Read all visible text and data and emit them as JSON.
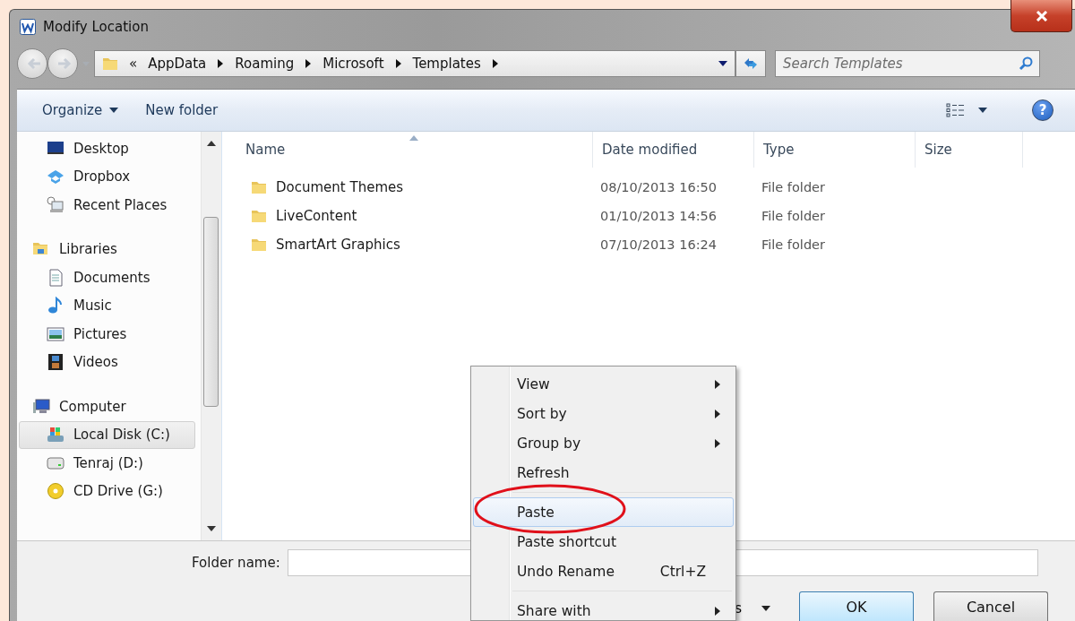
{
  "window": {
    "title": "Modify Location"
  },
  "address": {
    "overflow": "«",
    "segments": [
      "AppData",
      "Roaming",
      "Microsoft",
      "Templates"
    ]
  },
  "search": {
    "placeholder": "Search Templates"
  },
  "toolbar": {
    "organize": "Organize",
    "new_folder": "New folder",
    "help": "?"
  },
  "sidebar": {
    "sections": [
      {
        "children": [
          {
            "label": "Desktop",
            "selected": false
          },
          {
            "label": "Dropbox",
            "selected": false
          },
          {
            "label": "Recent Places",
            "selected": false
          }
        ]
      },
      {
        "label": "Libraries",
        "selected": false,
        "children": [
          {
            "label": "Documents",
            "selected": false
          },
          {
            "label": "Music",
            "selected": false
          },
          {
            "label": "Pictures",
            "selected": false
          },
          {
            "label": "Videos",
            "selected": false
          }
        ]
      },
      {
        "label": "Computer",
        "selected": false,
        "children": [
          {
            "label": "Local Disk (C:)",
            "selected": true
          },
          {
            "label": "Tenraj (D:)",
            "selected": false
          },
          {
            "label": "CD Drive (G:)",
            "selected": false
          }
        ]
      }
    ]
  },
  "table": {
    "columns": [
      "Name",
      "Date modified",
      "Type",
      "Size"
    ],
    "rows": [
      {
        "name": "Document Themes",
        "date": "08/10/2013 16:50",
        "type": "File folder"
      },
      {
        "name": "LiveContent",
        "date": "01/10/2013 14:56",
        "type": "File folder"
      },
      {
        "name": "SmartArt Graphics",
        "date": "07/10/2013 16:24",
        "type": "File folder"
      }
    ]
  },
  "folder_name": {
    "label": "Folder name:"
  },
  "buttons": [
    {
      "label": "s",
      "kind": "dropdown"
    },
    {
      "label": "OK",
      "kind": "default"
    },
    {
      "label": "Cancel",
      "kind": "plain"
    }
  ],
  "context_menu": {
    "items": [
      {
        "kind": "item",
        "label": "View",
        "submenu": true,
        "selected": false
      },
      {
        "kind": "item",
        "label": "Sort by",
        "submenu": true,
        "selected": false
      },
      {
        "kind": "item",
        "label": "Group by",
        "submenu": true,
        "selected": false
      },
      {
        "kind": "item",
        "label": "Refresh",
        "submenu": false,
        "selected": false
      },
      {
        "kind": "separator"
      },
      {
        "kind": "item",
        "label": "Paste",
        "submenu": false,
        "selected": true
      },
      {
        "kind": "item",
        "label": "Paste shortcut",
        "submenu": false,
        "selected": false
      },
      {
        "kind": "item",
        "label": "Undo Rename",
        "shortcut": "Ctrl+Z",
        "submenu": false,
        "selected": false
      },
      {
        "kind": "separator"
      },
      {
        "kind": "item",
        "label": "Share with",
        "submenu": true,
        "selected": false
      }
    ]
  },
  "annotation": {
    "kind": "ellipse"
  }
}
